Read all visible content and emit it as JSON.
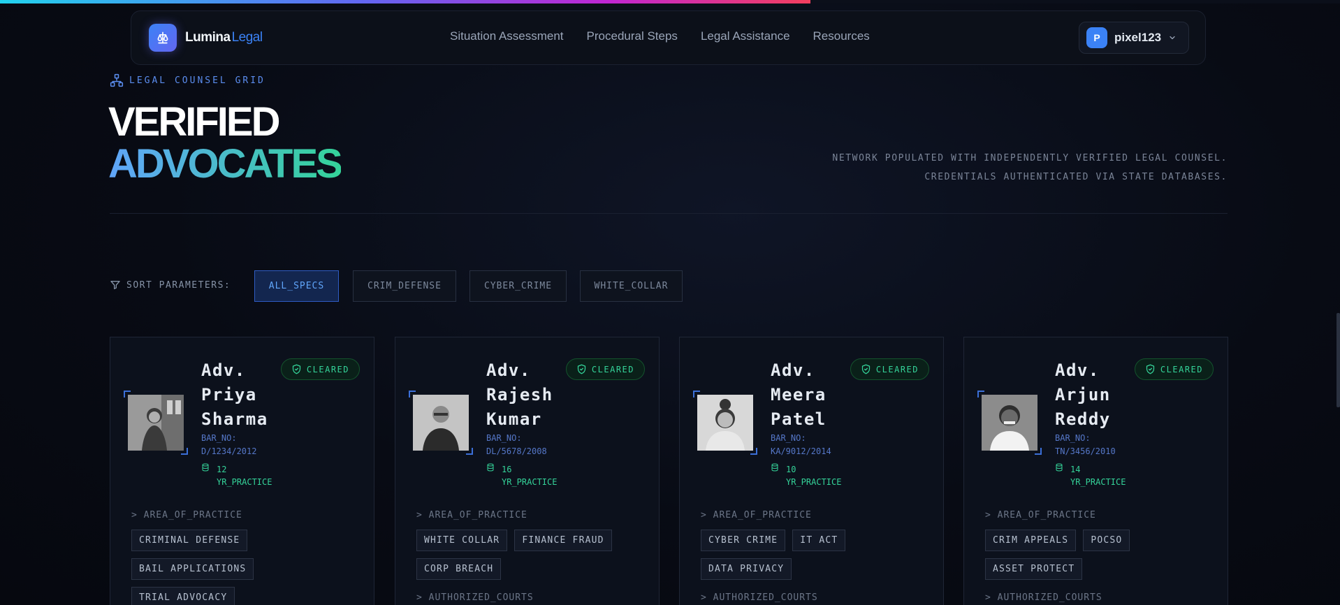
{
  "progress": {
    "value_percent": 60.5
  },
  "brand": {
    "name": "Lumina",
    "accent": "Legal",
    "logo_icon": "scale-icon"
  },
  "nav": {
    "links": [
      "Situation Assessment",
      "Procedural Steps",
      "Legal Assistance",
      "Resources"
    ]
  },
  "user": {
    "initial": "P",
    "name": "pixel123"
  },
  "header": {
    "eyebrow": "LEGAL COUNSEL GRID",
    "title_line1": "VERIFIED",
    "title_line2": "ADVOCATES",
    "tagline": "NETWORK POPULATED WITH INDEPENDENTLY VERIFIED LEGAL COUNSEL. CREDENTIALS AUTHENTICATED VIA STATE DATABASES."
  },
  "filters": {
    "label": "SORT PARAMETERS:",
    "options": [
      "ALL_SPECS",
      "CRIM_DEFENSE",
      "CYBER_CRIME",
      "WHITE_COLLAR"
    ],
    "active": "ALL_SPECS"
  },
  "colors": {
    "accent": "#3b82f6",
    "cleared": "#34d399",
    "background": "#080b14"
  },
  "advocates": [
    {
      "name": "Adv. Priya Sharma",
      "badge": "CLEARED",
      "bar_label": "BAR_NO:",
      "bar_no": "D/1234/2012",
      "years": "12",
      "years_unit": "YR_PRACTICE",
      "practice_heading": "> AREA_OF_PRACTICE",
      "practice": [
        "CRIMINAL DEFENSE",
        "BAIL APPLICATIONS",
        "TRIAL ADVOCACY"
      ],
      "courts_heading": "> AUTHORIZED_COURTS"
    },
    {
      "name": "Adv. Rajesh Kumar",
      "badge": "CLEARED",
      "bar_label": "BAR_NO:",
      "bar_no": "DL/5678/2008",
      "years": "16",
      "years_unit": "YR_PRACTICE",
      "practice_heading": "> AREA_OF_PRACTICE",
      "practice": [
        "WHITE COLLAR",
        "FINANCE FRAUD",
        "CORP BREACH"
      ],
      "courts_heading": "> AUTHORIZED_COURTS"
    },
    {
      "name": "Adv. Meera Patel",
      "badge": "CLEARED",
      "bar_label": "BAR_NO:",
      "bar_no": "KA/9012/2014",
      "years": "10",
      "years_unit": "YR_PRACTICE",
      "practice_heading": "> AREA_OF_PRACTICE",
      "practice": [
        "CYBER CRIME",
        "IT ACT",
        "DATA PRIVACY"
      ],
      "courts_heading": "> AUTHORIZED_COURTS"
    },
    {
      "name": "Adv. Arjun Reddy",
      "badge": "CLEARED",
      "bar_label": "BAR_NO:",
      "bar_no": "TN/3456/2010",
      "years": "14",
      "years_unit": "YR_PRACTICE",
      "practice_heading": "> AREA_OF_PRACTICE",
      "practice": [
        "CRIM APPEALS",
        "POCSO",
        "ASSET PROTECT"
      ],
      "courts_heading": "> AUTHORIZED_COURTS"
    }
  ]
}
